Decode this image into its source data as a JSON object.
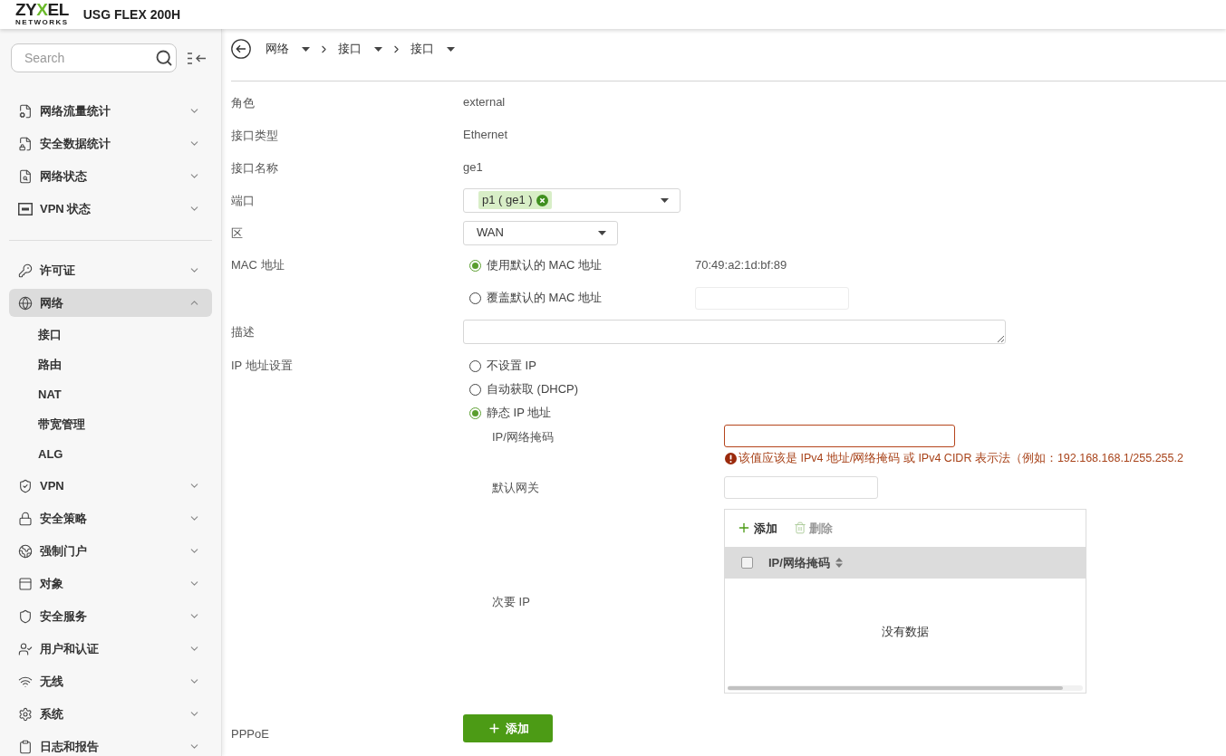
{
  "header": {
    "logo": {
      "start": "ZY",
      "accent": "X",
      "end": "EL",
      "tagline": "NETWORKS"
    },
    "model": "USG FLEX 200H"
  },
  "sidebar": {
    "search": {
      "placeholder": "Search"
    },
    "sections": [
      {
        "items": [
          {
            "label": "网络流量统计",
            "selected": false,
            "expanded": false
          },
          {
            "label": "安全数据统计",
            "selected": false,
            "expanded": false
          },
          {
            "label": "网络状态",
            "selected": false,
            "expanded": false
          },
          {
            "label": "VPN 状态",
            "selected": false,
            "expanded": false
          }
        ]
      },
      {
        "items": [
          {
            "label": "许可证",
            "selected": false,
            "expanded": false
          },
          {
            "label": "网络",
            "selected": true,
            "expanded": true,
            "children": [
              {
                "label": "接口"
              },
              {
                "label": "路由"
              },
              {
                "label": "NAT"
              },
              {
                "label": "带宽管理"
              },
              {
                "label": "ALG"
              }
            ]
          },
          {
            "label": "VPN",
            "selected": false,
            "expanded": false
          },
          {
            "label": "安全策略",
            "selected": false,
            "expanded": false
          },
          {
            "label": "强制门户",
            "selected": false,
            "expanded": false
          },
          {
            "label": "对象",
            "selected": false,
            "expanded": false
          },
          {
            "label": "安全服务",
            "selected": false,
            "expanded": false
          },
          {
            "label": "用户和认证",
            "selected": false,
            "expanded": false
          },
          {
            "label": "无线",
            "selected": false,
            "expanded": false
          },
          {
            "label": "系统",
            "selected": false,
            "expanded": false
          },
          {
            "label": "日志和报告",
            "selected": false,
            "expanded": false
          }
        ]
      }
    ]
  },
  "breadcrumb": [
    {
      "label": "网络"
    },
    {
      "label": "接口"
    },
    {
      "label": "接口"
    }
  ],
  "form": {
    "rows": [
      {
        "kind": "text",
        "label": "角色",
        "value": "external"
      },
      {
        "kind": "text",
        "label": "接口类型",
        "value": "Ethernet"
      },
      {
        "kind": "text",
        "label": "接口名称",
        "value": "ge1"
      },
      {
        "kind": "tags",
        "label": "端口",
        "tags": [
          "p1 ( ge1 )"
        ]
      },
      {
        "kind": "select",
        "label": "区",
        "value": "WAN"
      },
      {
        "kind": "radios",
        "label": "MAC 地址",
        "options": [
          {
            "label": "使用默认的 MAC 地址",
            "selected": true,
            "kind": "reading",
            "value": "70:49:a2:1d:bf:89"
          },
          {
            "label": "覆盖默认的 MAC 地址",
            "selected": false,
            "kind": "field"
          }
        ]
      },
      {
        "kind": "textarea",
        "label": "描述"
      },
      {
        "kind": "ip",
        "label": "IP 地址设置",
        "options": [
          {
            "label": "不设置 IP",
            "selected": false
          },
          {
            "label": "自动获取 (DHCP)",
            "selected": false
          },
          {
            "label": "静态 IP 地址",
            "selected": true
          }
        ],
        "fields": [
          {
            "kind": "input",
            "label": "IP/网络掩码",
            "invalid": true,
            "error": "该值应该是 IPv4 地址/网络掩码 或 IPv4 CIDR 表示法（例如：192.168.168.1/255.255.2"
          },
          {
            "kind": "input",
            "label": "默认网关",
            "invalid": false
          },
          {
            "kind": "table",
            "label": "次要 IP",
            "toolbar": [
              {
                "label": "添加",
                "disabled": false
              },
              {
                "label": "删除",
                "disabled": true
              }
            ],
            "select_all": {
              "checked": false
            },
            "columns": [
              {
                "label": "IP/网络掩码"
              }
            ],
            "empty_text": "没有数据"
          }
        ]
      },
      {
        "kind": "button",
        "label": "PPPoE",
        "button": "添加"
      }
    ]
  }
}
